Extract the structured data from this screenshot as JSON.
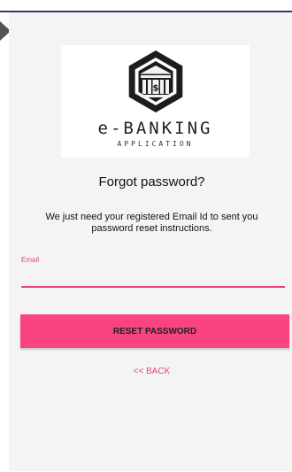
{
  "colors": {
    "top_line": "#2f3a78",
    "accent": "#e8437f",
    "button_bg": "#fa4383",
    "card_bg": "#f4f4f4"
  },
  "icons": {
    "nav": "left-nav-arrow-icon",
    "logo": "bank-dollar-icon"
  },
  "logo": {
    "name": "e-BANKING",
    "subtitle": "APPLICATION"
  },
  "page": {
    "title": "Forgot password?",
    "description": "We just need your registered Email Id to sent you password reset instructions."
  },
  "form": {
    "email_label": "Email",
    "email_value": "",
    "reset_label": "RESET PASSWORD",
    "back_label": "<< BACK"
  }
}
